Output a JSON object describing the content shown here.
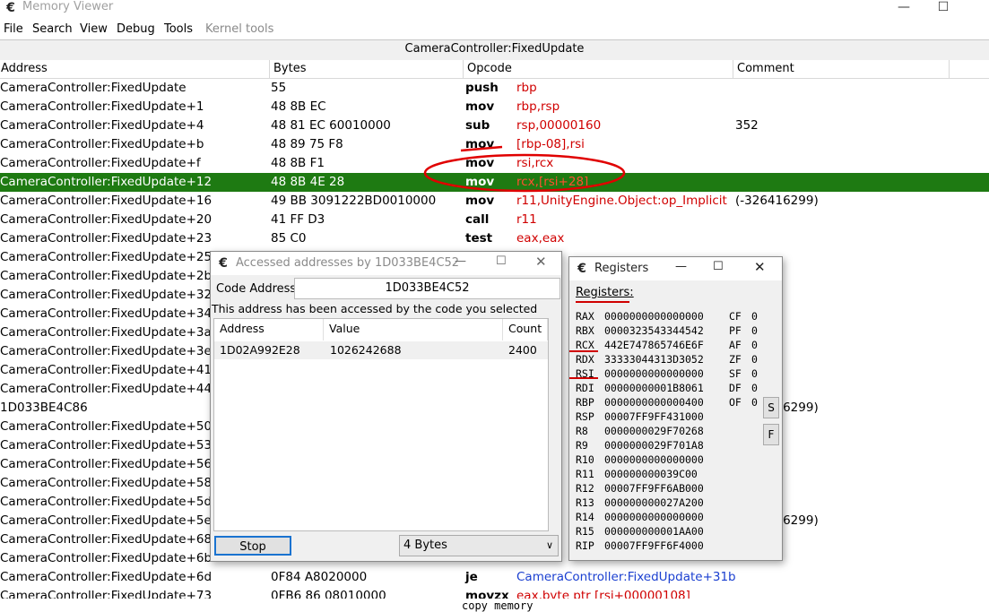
{
  "window": {
    "title": "Memory Viewer",
    "minimize": "—",
    "maximize": "☐"
  },
  "menu": [
    "File",
    "Search",
    "View",
    "Debug",
    "Tools",
    "Kernel tools"
  ],
  "function_header": "CameraController:FixedUpdate",
  "columns": {
    "address": "Address",
    "bytes": "Bytes",
    "opcode": "Opcode",
    "comment": "Comment"
  },
  "rows": [
    {
      "address": "CameraController:FixedUpdate",
      "bytes": "55",
      "op": "push",
      "args": "rbp",
      "comment": ""
    },
    {
      "address": "CameraController:FixedUpdate+1",
      "bytes": "48 8B EC",
      "op": "mov",
      "args": "rbp,rsp",
      "comment": ""
    },
    {
      "address": "CameraController:FixedUpdate+4",
      "bytes": "48 81 EC 60010000",
      "op": "sub",
      "args": "rsp,00000160",
      "comment": "352"
    },
    {
      "address": "CameraController:FixedUpdate+b",
      "bytes": "48 89 75 F8",
      "op": "mov",
      "args": "[rbp-08],rsi",
      "comment": ""
    },
    {
      "address": "CameraController:FixedUpdate+f",
      "bytes": "48 8B F1",
      "op": "mov",
      "args": "rsi,rcx",
      "comment": ""
    },
    {
      "address": "CameraController:FixedUpdate+12",
      "bytes": "48 8B 4E 28",
      "op": "mov",
      "args": "rcx,[rsi+28]",
      "comment": "",
      "selected": true
    },
    {
      "address": "CameraController:FixedUpdate+16",
      "bytes": "49 BB 3091222BD0010000",
      "op": "mov",
      "args": "r11,UnityEngine.Object:op_Implicit",
      "comment": "(-326416299)"
    },
    {
      "address": "CameraController:FixedUpdate+20",
      "bytes": "41 FF D3",
      "op": "call",
      "args": "r11",
      "comment": ""
    },
    {
      "address": "CameraController:FixedUpdate+23",
      "bytes": "85 C0",
      "op": "test",
      "args": "eax,eax",
      "comment": ""
    },
    {
      "address": "CameraController:FixedUpdate+25",
      "bytes": "",
      "op": "",
      "args": "",
      "comment": ""
    },
    {
      "address": "CameraController:FixedUpdate+2b",
      "bytes": "",
      "op": "",
      "args": "",
      "comment": ""
    },
    {
      "address": "CameraController:FixedUpdate+32",
      "bytes": "",
      "op": "",
      "args": "",
      "comment": ""
    },
    {
      "address": "CameraController:FixedUpdate+34",
      "bytes": "",
      "op": "",
      "args": "",
      "comment": ""
    },
    {
      "address": "CameraController:FixedUpdate+3a",
      "bytes": "",
      "op": "",
      "args": "",
      "comment": ""
    },
    {
      "address": "CameraController:FixedUpdate+3e",
      "bytes": "",
      "op": "",
      "args": "",
      "comment": ""
    },
    {
      "address": "CameraController:FixedUpdate+41",
      "bytes": "",
      "op": "",
      "args": "",
      "comment": ""
    },
    {
      "address": "CameraController:FixedUpdate+44",
      "bytes": "",
      "op": "",
      "args": "",
      "comment": ""
    },
    {
      "address": "1D033BE4C86",
      "bytes": "",
      "op": "",
      "args": "",
      "comment": "(-326416299)"
    },
    {
      "address": "CameraController:FixedUpdate+50",
      "bytes": "",
      "op": "",
      "args": "",
      "comment": ""
    },
    {
      "address": "CameraController:FixedUpdate+53",
      "bytes": "",
      "op": "",
      "args": "",
      "comment": ""
    },
    {
      "address": "CameraController:FixedUpdate+56",
      "bytes": "",
      "op": "",
      "args": "",
      "comment": ""
    },
    {
      "address": "CameraController:FixedUpdate+58",
      "bytes": "",
      "op": "",
      "args": "",
      "comment": ""
    },
    {
      "address": "CameraController:FixedUpdate+5d",
      "bytes": "",
      "op": "",
      "args": "",
      "comment": ""
    },
    {
      "address": "CameraController:FixedUpdate+5e",
      "bytes": "",
      "op": "",
      "args": "",
      "comment": "(-326416299)"
    },
    {
      "address": "CameraController:FixedUpdate+68",
      "bytes": "",
      "op": "",
      "args": "",
      "comment": ""
    },
    {
      "address": "CameraController:FixedUpdate+6b",
      "bytes": "",
      "op": "",
      "args": "",
      "comment": ""
    },
    {
      "address": "CameraController:FixedUpdate+6d",
      "bytes": "0F84 A8020000",
      "op": "je",
      "args": "CameraController:FixedUpdate+31b",
      "comment": ""
    },
    {
      "address": "CameraController:FixedUpdate+73",
      "bytes": "0FB6 86 08010000",
      "op": "movzx",
      "args": "eax,byte ptr [rsi+00000108]",
      "comment": ""
    }
  ],
  "bottom_text": "copy memory",
  "accessed_dialog": {
    "title": "Accessed addresses by 1D033BE4C52",
    "code_address_label": "Code Address",
    "code_address_value": "1D033BE4C52",
    "info": "This address has been accessed by the code you selected",
    "columns": [
      "Address",
      "Value",
      "Count"
    ],
    "entries": [
      {
        "address": "1D02A992E28",
        "value": "1026242688",
        "count": "2400"
      }
    ],
    "stop_label": "Stop",
    "size_option": "4 Bytes"
  },
  "registers_dialog": {
    "title": "Registers",
    "label": "Registers:",
    "registers": [
      {
        "name": "RAX",
        "value": "0000000000000000"
      },
      {
        "name": "RBX",
        "value": "0000323543344542"
      },
      {
        "name": "RCX",
        "value": "442E747865746E6F"
      },
      {
        "name": "RDX",
        "value": "33333044313D3052"
      },
      {
        "name": "RSI",
        "value": "0000000000000000"
      },
      {
        "name": "RDI",
        "value": "00000000001B8061"
      },
      {
        "name": "RBP",
        "value": "0000000000000400"
      },
      {
        "name": "RSP",
        "value": "00007FF9FF431000"
      },
      {
        "name": "R8",
        "value": "0000000029F70268"
      },
      {
        "name": "R9",
        "value": "0000000029F701A8"
      },
      {
        "name": "R10",
        "value": "0000000000000000"
      },
      {
        "name": "R11",
        "value": "000000000039C00"
      },
      {
        "name": "R12",
        "value": "00007FF9FF6AB000"
      },
      {
        "name": "R13",
        "value": "000000000027A200"
      },
      {
        "name": "R14",
        "value": "0000000000000000"
      },
      {
        "name": "R15",
        "value": "000000000001AA00"
      },
      {
        "name": "RIP",
        "value": "00007FF9FF6F4000"
      }
    ],
    "flags": [
      {
        "name": "CF",
        "value": "0"
      },
      {
        "name": "PF",
        "value": "0"
      },
      {
        "name": "AF",
        "value": "0"
      },
      {
        "name": "ZF",
        "value": "0"
      },
      {
        "name": "SF",
        "value": "0"
      },
      {
        "name": "DF",
        "value": "0"
      },
      {
        "name": "OF",
        "value": "0"
      }
    ],
    "s_button": "S",
    "f_button": "F"
  },
  "colors": {
    "selected_row": "#1e7a12",
    "operand": "#d00000",
    "symbol": "#1a3fd0",
    "annotation": "#e00000"
  }
}
